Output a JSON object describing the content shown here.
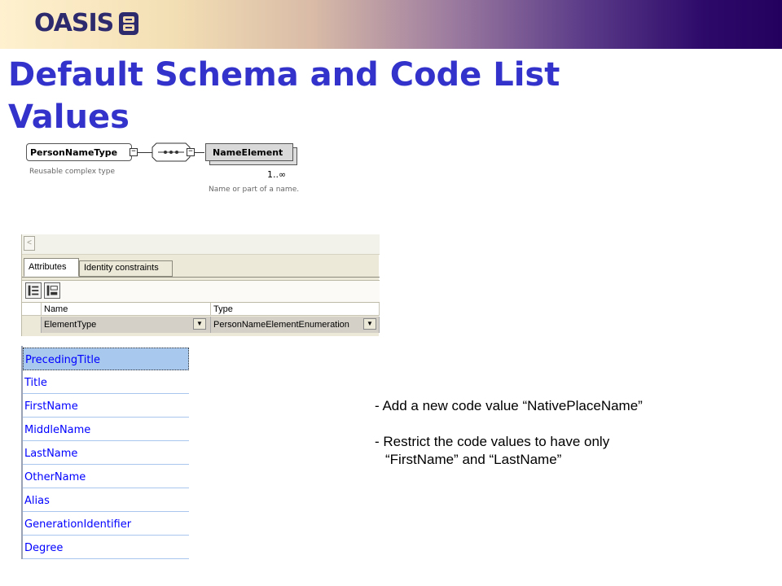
{
  "header": {
    "logo_text": "OASIS",
    "brand_color": "#2d2a6e"
  },
  "title": {
    "line1": "Default Schema and Code List",
    "line2": "Values",
    "color": "#3333cc"
  },
  "diagram": {
    "root_name": "PersonNameType",
    "root_desc": "Reusable complex type",
    "element_name": "NameElement",
    "cardinality": "1..∞",
    "element_desc": "Name or part of a name."
  },
  "panel": {
    "tabs": [
      {
        "label": "Attributes",
        "active": true
      },
      {
        "label": "Identity constraints",
        "active": false
      }
    ],
    "columns": [
      "Name",
      "Type"
    ],
    "row": {
      "name": "ElementType",
      "type": "PersonNameElementEnumeration"
    }
  },
  "code_list": [
    {
      "label": "PrecedingTitle",
      "selected": true
    },
    {
      "label": "Title",
      "selected": false
    },
    {
      "label": "FirstName",
      "selected": false
    },
    {
      "label": "MiddleName",
      "selected": false
    },
    {
      "label": "LastName",
      "selected": false
    },
    {
      "label": "OtherName",
      "selected": false
    },
    {
      "label": "Alias",
      "selected": false
    },
    {
      "label": "GenerationIdentifier",
      "selected": false
    },
    {
      "label": "Degree",
      "selected": false
    }
  ],
  "notes": {
    "item1": "- Add a new code value “NativePlaceName”",
    "item2_line1": "- Restrict the code values to have only",
    "item2_line2": "“FirstName” and “LastName”"
  }
}
